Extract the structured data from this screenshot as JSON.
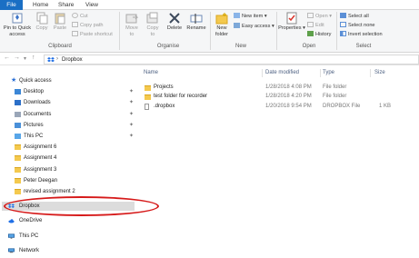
{
  "tabs": [
    {
      "label": "File"
    },
    {
      "label": "Home"
    },
    {
      "label": "Share"
    },
    {
      "label": "View"
    }
  ],
  "ribbon": {
    "clipboard": {
      "label": "Clipboard",
      "pin_label_1": "Pin to Quick",
      "pin_label_2": "access",
      "copy": "Copy",
      "paste": "Paste",
      "cut": "Cut",
      "copy_path": "Copy path",
      "paste_shortcut": "Paste shortcut"
    },
    "organise": {
      "label": "Organise",
      "move_to_1": "Move",
      "move_to_2": "to",
      "copy_to_1": "Copy",
      "copy_to_2": "to",
      "delete": "Delete",
      "rename": "Rename"
    },
    "new": {
      "label": "New",
      "new_folder_1": "New",
      "new_folder_2": "folder",
      "new_item": "New item",
      "easy_access": "Easy access"
    },
    "open": {
      "label": "Open",
      "properties": "Properties",
      "open": "Open",
      "edit": "Edit",
      "history": "History"
    },
    "select": {
      "label": "Select",
      "select_all": "Select all",
      "select_none": "Select none",
      "invert_selection": "Invert selection"
    }
  },
  "address": {
    "path": "Dropbox"
  },
  "nav": {
    "quick_access": "Quick access",
    "items": [
      {
        "label": "Desktop",
        "pinned": true
      },
      {
        "label": "Downloads",
        "pinned": true
      },
      {
        "label": "Documents",
        "pinned": true
      },
      {
        "label": "Pictures",
        "pinned": true
      },
      {
        "label": "This PC",
        "pinned": true
      },
      {
        "label": "Assignment 6",
        "pinned": false
      },
      {
        "label": "Assignment 4",
        "pinned": false
      },
      {
        "label": "Assignment 3",
        "pinned": false
      },
      {
        "label": "Peter Deegan",
        "pinned": false
      },
      {
        "label": "revised assignment 2",
        "pinned": false
      }
    ],
    "dropbox": "Dropbox",
    "onedrive": "OneDrive",
    "this_pc": "This PC",
    "network": "Network"
  },
  "content": {
    "columns": [
      "Name",
      "Date modified",
      "Type",
      "Size"
    ],
    "rows": [
      {
        "name": "Projects",
        "date": "1/28/2018 4:08 PM",
        "type": "File folder",
        "size": ""
      },
      {
        "name": "test folder for recorder",
        "date": "1/28/2018 4:20 PM",
        "type": "File folder",
        "size": ""
      },
      {
        "name": ".dropbox",
        "date": "1/20/2018 9:54 PM",
        "type": "DROPBOX File",
        "size": "1 KB"
      }
    ]
  },
  "colors": {
    "file_tab": "#1a6fc4",
    "highlight_circle": "#d61a1a",
    "folder": "#f4c94e"
  }
}
